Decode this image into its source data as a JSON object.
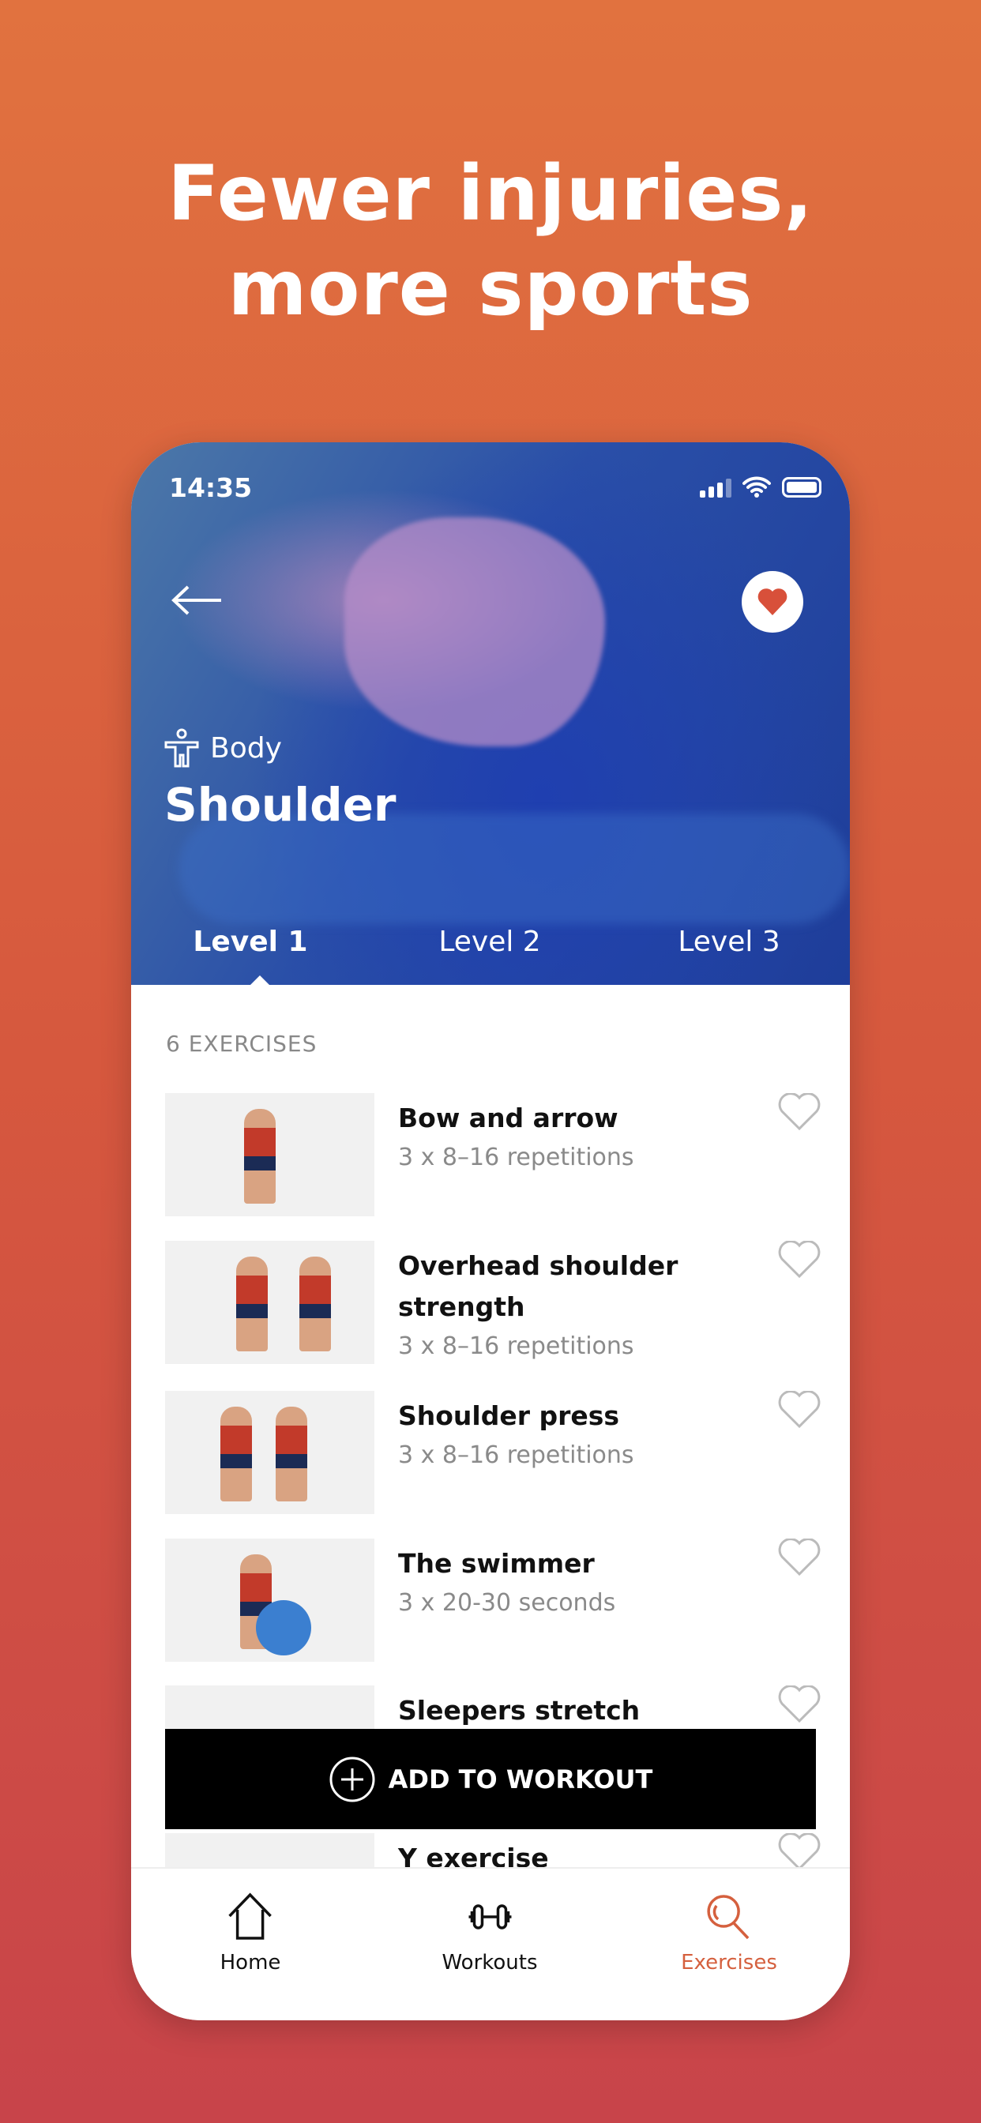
{
  "headline": {
    "line1": "Fewer injuries,",
    "line2": "more sports"
  },
  "status": {
    "time": "14:35"
  },
  "hero": {
    "category": "Body",
    "title": "Shoulder",
    "favorited": true
  },
  "tabs": [
    {
      "label": "Level 1",
      "active": true
    },
    {
      "label": "Level 2"
    },
    {
      "label": "Level 3"
    }
  ],
  "count": "6 EXERCISES",
  "exercises": [
    {
      "title": "Bow and arrow",
      "sub": "3 x 8–16 repetitions"
    },
    {
      "title": "Overhead shoulder strength",
      "sub": "3 x 8–16 repetitions"
    },
    {
      "title": "Shoulder press",
      "sub": "3 x 8–16 repetitions"
    },
    {
      "title": "The swimmer",
      "sub": "3 x 20-30 seconds"
    },
    {
      "title": "Sleepers stretch",
      "sub": ""
    },
    {
      "title": "Y exercise",
      "sub": ""
    }
  ],
  "add_button": "ADD TO WORKOUT",
  "nav": [
    {
      "label": "Home",
      "icon": "home-icon"
    },
    {
      "label": "Workouts",
      "icon": "dumbbell-icon"
    },
    {
      "label": "Exercises",
      "icon": "search-icon",
      "active": true
    }
  ],
  "colors": {
    "accent": "#d5603e",
    "heart": "#d8503a"
  }
}
